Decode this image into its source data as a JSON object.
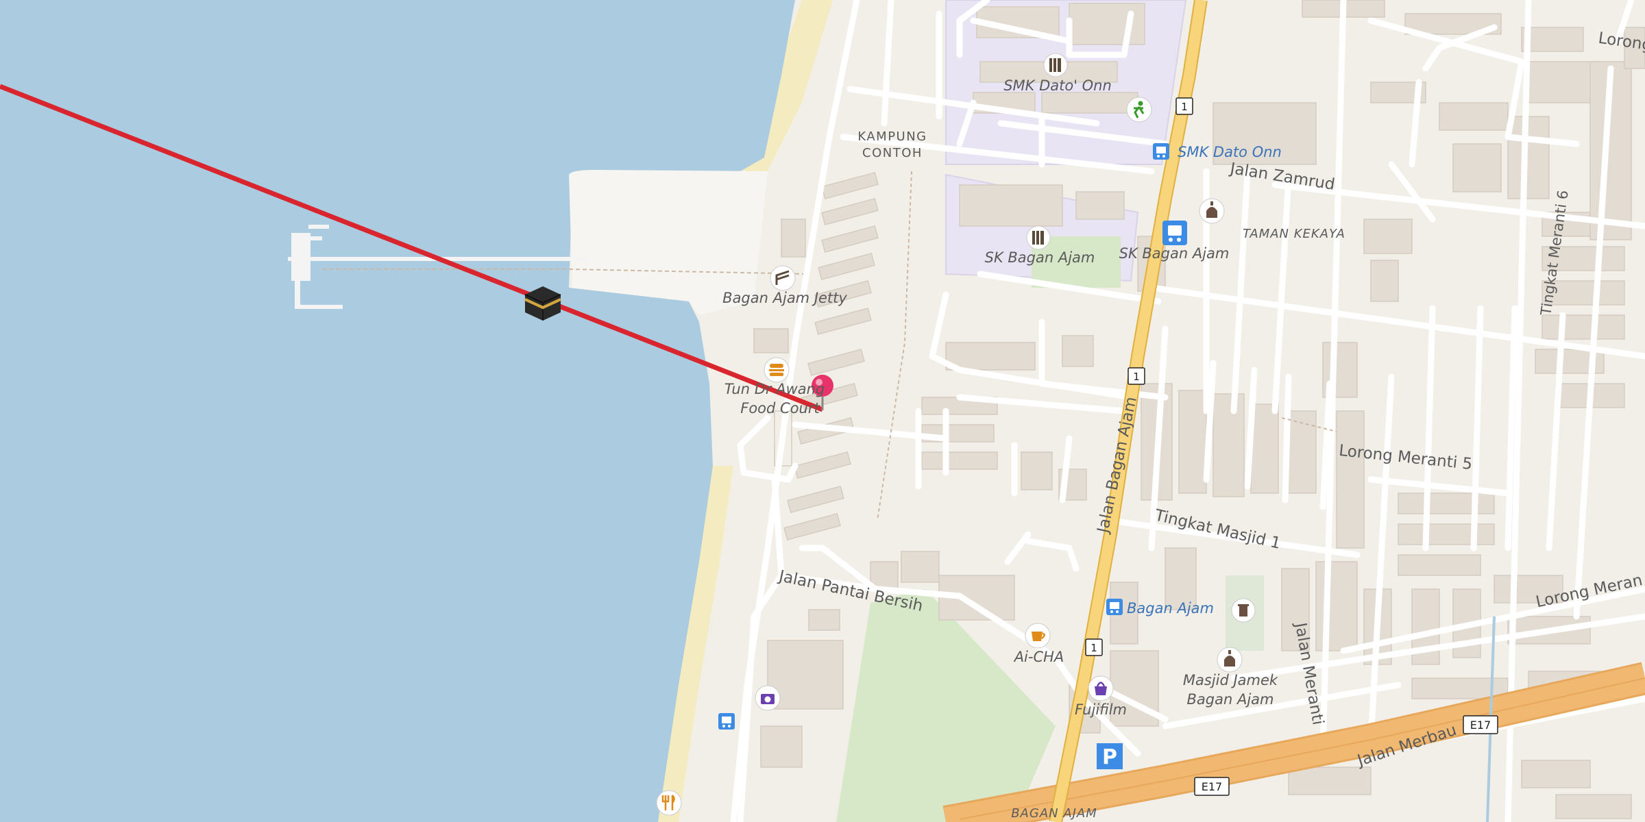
{
  "map": {
    "places": {
      "school_1": "SMK Dato' Onn",
      "neighbourhood_1": "KAMPUNG",
      "neighbourhood_2": "CONTOH",
      "bus_stop_1": "SMK Dato Onn",
      "street_zamrud": "Jalan Zamrud",
      "area_kekaya": "TAMAN KEKAYA",
      "school_2": "SK Bagan Ajam",
      "bus_stop_2": "SK Bagan Ajam",
      "jetty": "Bagan Ajam Jetty",
      "food_court_1": "Tun Dr Awang",
      "food_court_2": "Food Court",
      "street_main": "Jalan Bagan Ajam",
      "street_lorong_meranti_5": "Lorong Meranti 5",
      "street_tingkat_masjid": "Tingkat Masjid 1",
      "street_pantai": "Jalan Pantai Bersih",
      "bus_stop_3": "Bagan Ajam",
      "cafe": "Ai-CHA",
      "mosque_1": "Masjid Jamek",
      "mosque_2": "Bagan Ajam",
      "shop": "Fujifilm",
      "street_jalan_meranti": "Jalan Meranti",
      "street_lorong_meranti_e": "Lorong Meran",
      "street_lorong_top": "Lorong",
      "street_tingkat_meranti_6": "Tingkat Meranti 6",
      "street_merbau": "Jalan Merbau",
      "area_bottom": "BAGAN AJAM"
    },
    "shields": {
      "route_1": "1",
      "route_e17": "E17"
    },
    "parking": "P",
    "colors": {
      "water": "#aacbe0",
      "land": "#f2efe9",
      "beach": "#f4ebc1",
      "school_area": "#e8e4f3",
      "park": "#d7e8c8",
      "building": "#e3dcd3",
      "primary_road": "#f8d57a",
      "motorway": "#f0b870",
      "route_line": "#d9262e",
      "pin": "#e8336a"
    },
    "icons": [
      "school-icon",
      "sports-icon",
      "bus-stop-icon",
      "mosque-icon",
      "jetty-icon",
      "fast-food-icon",
      "kaaba-icon",
      "location-pin-icon",
      "cafe-icon",
      "shop-icon",
      "camera-shop-icon",
      "restaurant-icon",
      "waste-icon",
      "parking-icon"
    ]
  }
}
